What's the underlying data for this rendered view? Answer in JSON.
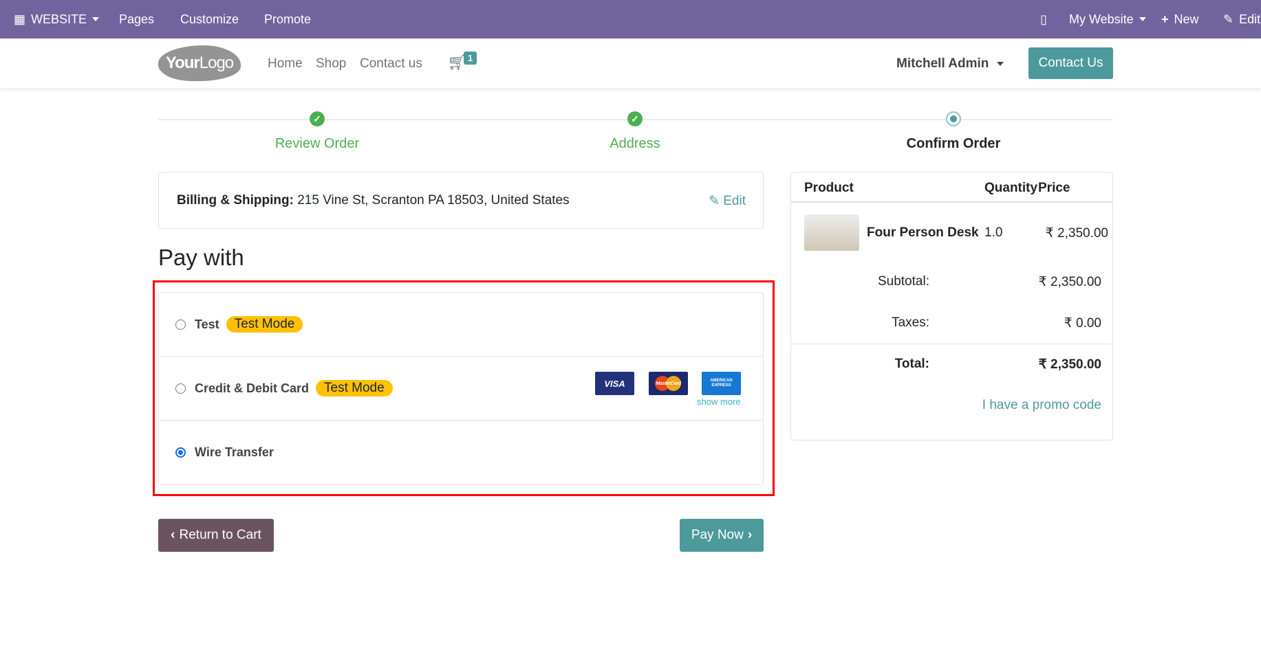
{
  "topbar": {
    "website": "WEBSITE",
    "pages": "Pages",
    "customize": "Customize",
    "promote": "Promote",
    "my_website": "My Website",
    "new": "New",
    "edit": "Edit"
  },
  "navbar": {
    "logo": "YourLogo",
    "links": [
      "Home",
      "Shop",
      "Contact us"
    ],
    "cart_count": "1",
    "user": "Mitchell Admin",
    "contact_button": "Contact Us"
  },
  "steps": [
    {
      "label": "Review Order",
      "state": "done"
    },
    {
      "label": "Address",
      "state": "done"
    },
    {
      "label": "Confirm Order",
      "state": "current"
    }
  ],
  "billing": {
    "label": "Billing & Shipping:",
    "address": "215 Vine St, Scranton PA 18503, United States",
    "edit": "Edit"
  },
  "pay_with": {
    "title": "Pay with",
    "methods": [
      {
        "name": "Test",
        "badge": "Test Mode",
        "selected": false
      },
      {
        "name": "Credit & Debit Card",
        "badge": "Test Mode",
        "selected": false,
        "cards": [
          "VISA",
          "MasterCard",
          "AMERICAN EXPRESS"
        ],
        "show_more": "show more"
      },
      {
        "name": "Wire Transfer",
        "selected": true
      }
    ]
  },
  "buttons": {
    "return": "Return to Cart",
    "pay": "Pay Now"
  },
  "summary": {
    "headers": [
      "Product",
      "Quantity",
      "Price"
    ],
    "product": "Four Person Desk",
    "quantity": "1.0",
    "price": "₹ 2,350.00",
    "subtotal_label": "Subtotal:",
    "subtotal": "₹ 2,350.00",
    "taxes_label": "Taxes:",
    "taxes": "₹ 0.00",
    "total_label": "Total:",
    "total": "₹ 2,350.00",
    "promo": "I have a promo code"
  },
  "colors": {
    "topbar": "#71639e",
    "primary": "#4c9a9c",
    "secondary": "#6b5460",
    "success": "#4caf50",
    "highlight": "#ff0000"
  }
}
